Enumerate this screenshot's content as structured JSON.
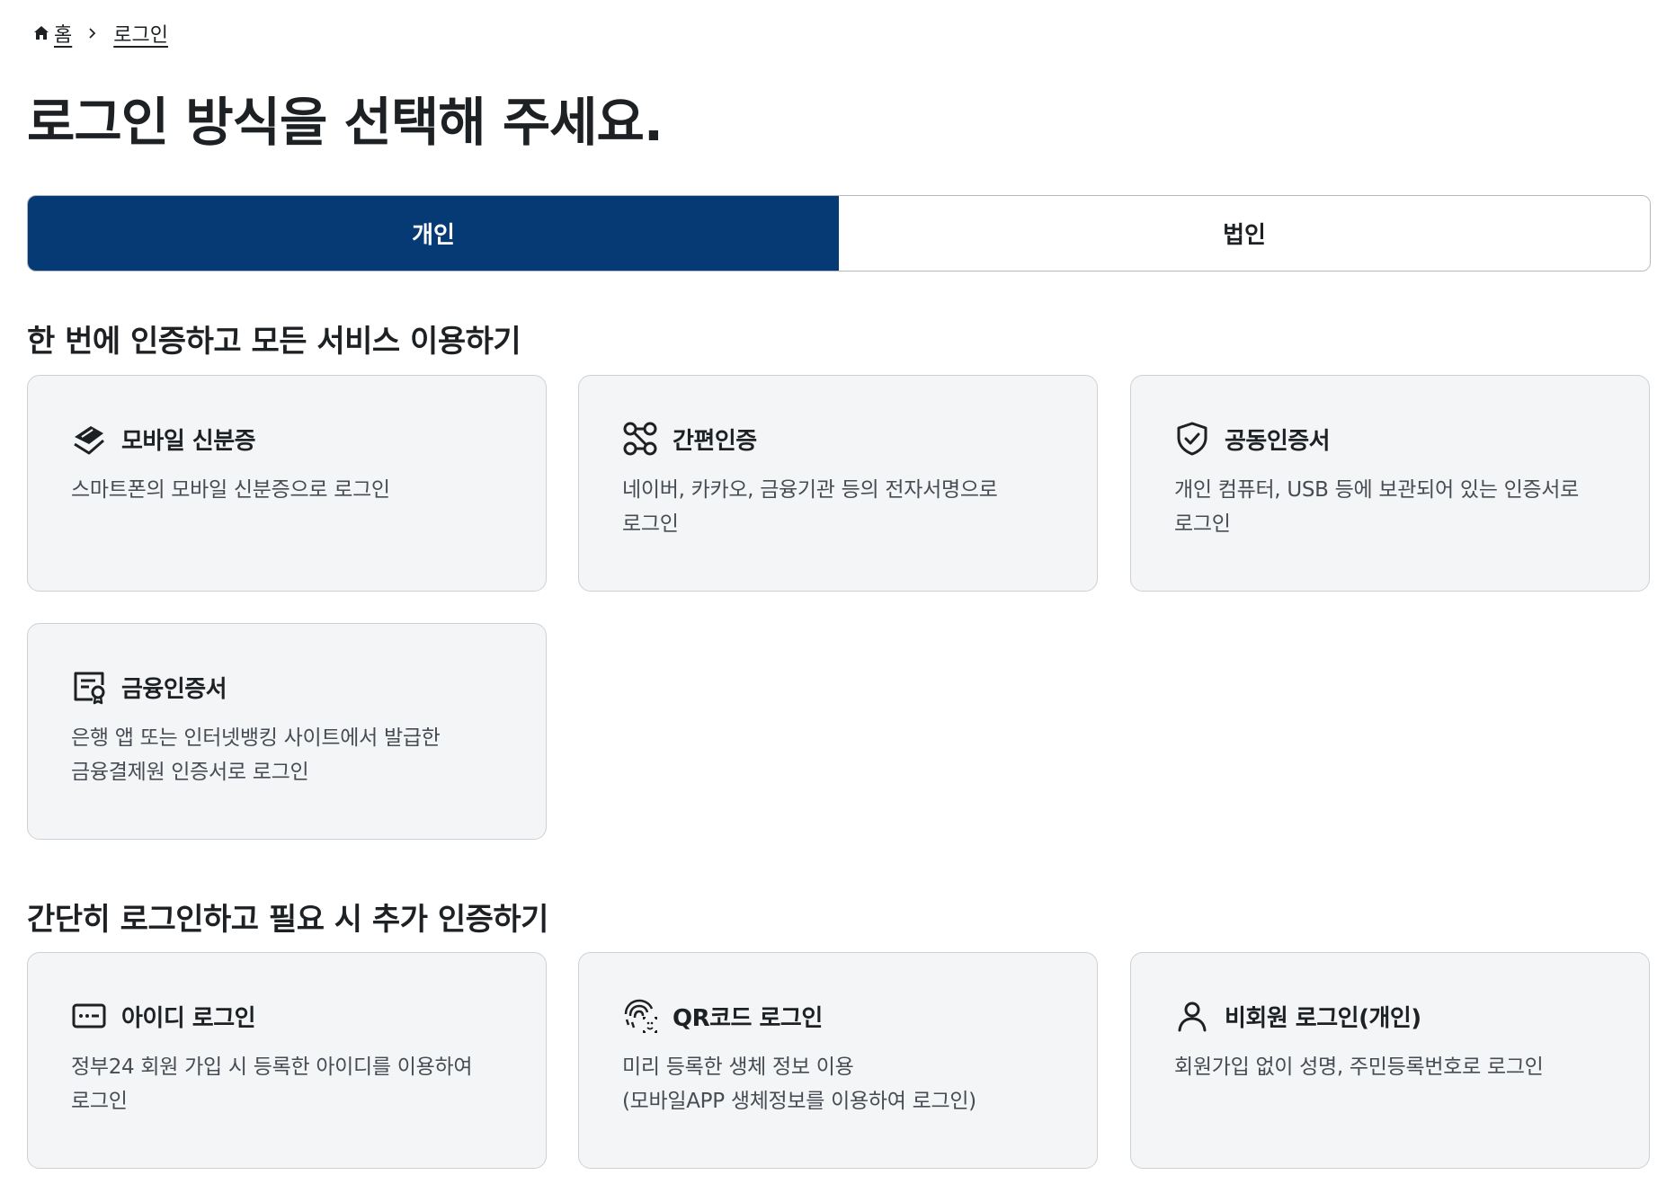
{
  "breadcrumb": {
    "home": "홈",
    "current": "로그인"
  },
  "page_title": "로그인 방식을 선택해 주세요.",
  "tabs": [
    {
      "label": "개인",
      "active": true
    },
    {
      "label": "법인",
      "active": false
    }
  ],
  "colors": {
    "accent": "#063a74",
    "card_bg": "#f4f5f6",
    "card_border": "#cdd1d5",
    "text": "#1e2124",
    "muted": "#464c53"
  },
  "section1": {
    "title": "한 번에 인증하고 모든 서비스 이용하기",
    "cards": [
      {
        "icon": "layers-icon",
        "title": "모바일 신분증",
        "desc": [
          "스마트폰의 모바일 신분증으로 로그인"
        ]
      },
      {
        "icon": "nodes-icon",
        "title": "간편인증",
        "desc": [
          "네이버, 카카오, 금융기관 등의 전자서명으로",
          "로그인"
        ]
      },
      {
        "icon": "shield-check-icon",
        "title": "공동인증서",
        "desc": [
          "개인 컴퓨터, USB 등에 보관되어 있는 인증서로",
          "로그인"
        ]
      },
      {
        "icon": "certificate-icon",
        "title": "금융인증서",
        "desc": [
          "은행 앱 또는 인터넷뱅킹 사이트에서 발급한",
          "금융결제원 인증서로 로그인"
        ]
      }
    ]
  },
  "section2": {
    "title": "간단히 로그인하고 필요 시 추가 인증하기",
    "cards": [
      {
        "icon": "id-password-icon",
        "title": "아이디 로그인",
        "desc": [
          "정부24 회원 가입 시 등록한 아이디를 이용하여",
          "로그인"
        ]
      },
      {
        "icon": "fingerprint-face-icon",
        "title": "QR코드 로그인",
        "desc": [
          "미리 등록한 생체 정보 이용",
          "(모바일APP 생체정보를 이용하여 로그인)"
        ]
      },
      {
        "icon": "user-icon",
        "title": "비회원 로그인(개인)",
        "desc": [
          "회원가입 없이 성명, 주민등록번호로 로그인"
        ]
      }
    ]
  }
}
